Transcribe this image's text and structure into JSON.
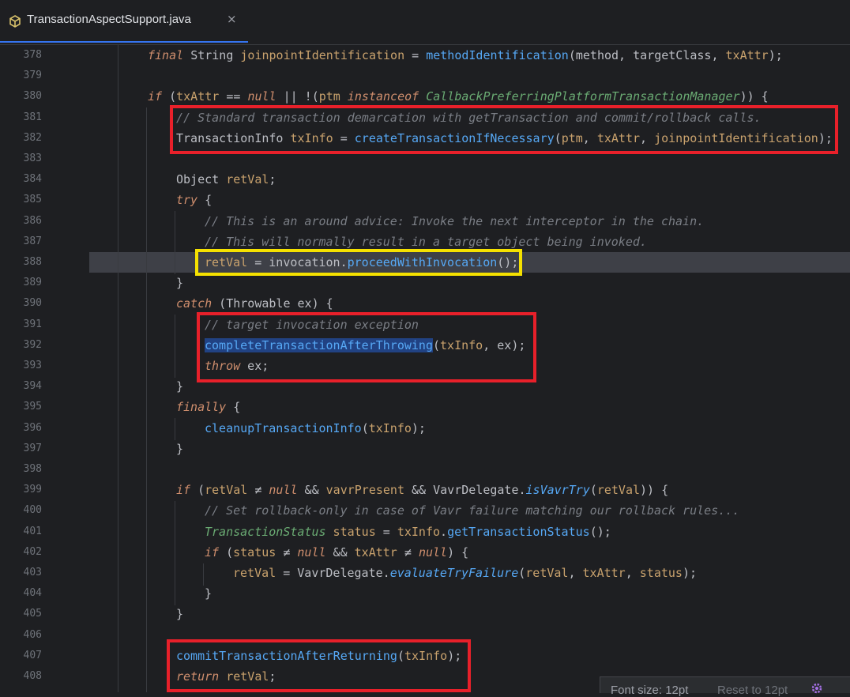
{
  "tab": {
    "title": "TransactionAspectSupport.java",
    "close_glyph": "×",
    "icon": "class-cube-icon"
  },
  "lines": [
    {
      "num": "378"
    },
    {
      "num": "379"
    },
    {
      "num": "380"
    },
    {
      "num": "381"
    },
    {
      "num": "382"
    },
    {
      "num": "383"
    },
    {
      "num": "384"
    },
    {
      "num": "385"
    },
    {
      "num": "386"
    },
    {
      "num": "387"
    },
    {
      "num": "388"
    },
    {
      "num": "389"
    },
    {
      "num": "390"
    },
    {
      "num": "391"
    },
    {
      "num": "392"
    },
    {
      "num": "393"
    },
    {
      "num": "394"
    },
    {
      "num": "395"
    },
    {
      "num": "396"
    },
    {
      "num": "397"
    },
    {
      "num": "398"
    },
    {
      "num": "399"
    },
    {
      "num": "400"
    },
    {
      "num": "401"
    },
    {
      "num": "402"
    },
    {
      "num": "403"
    },
    {
      "num": "404"
    },
    {
      "num": "405"
    },
    {
      "num": "406"
    },
    {
      "num": "407"
    },
    {
      "num": "408"
    }
  ],
  "code": {
    "l378": {
      "kw": "final",
      "type": "String",
      "var": "joinpointIdentification",
      "eq": " = ",
      "fn": "methodIdentification",
      "args": "(method, targetClass, ",
      "arg2": "txAttr",
      "end": ");"
    },
    "l380": {
      "kw": "if",
      "open": " (",
      "v1": "txAttr",
      "op": " == ",
      "null": "null",
      "or": " || !(",
      "v2": "ptm",
      "inst": " instanceof ",
      "cls": "CallbackPreferringPlatformTransactionManager",
      "end": ")) {"
    },
    "l381": {
      "comment": "// Standard transaction demarcation with getTransaction and commit/rollback calls."
    },
    "l382": {
      "type": "TransactionInfo",
      "var": " txInfo",
      "eq": " = ",
      "fn": "createTransactionIfNecessary",
      "a1": "(",
      "v1": "ptm",
      "c1": ", ",
      "v2": "txAttr",
      "c2": ", ",
      "v3": "joinpointIdentification",
      "end": ");"
    },
    "l384": {
      "type": "Object",
      "var": " retVal",
      "end": ";"
    },
    "l385": {
      "kw": "try",
      "end": " {"
    },
    "l386": {
      "comment": "// This is an around advice: Invoke the next interceptor in the chain."
    },
    "l387": {
      "comment": "// This will normally result in a target object being invoked."
    },
    "l388": {
      "v1": "retVal",
      "eq": " = ",
      "obj": "invocation.",
      "fn": "proceedWithInvocation",
      "end": "();"
    },
    "l389": {
      "text": "}"
    },
    "l390": {
      "kw": "catch",
      "open": " (",
      "type": "Throwable",
      "var": " ex",
      "end": ") {"
    },
    "l391": {
      "comment": "// target invocation exception"
    },
    "l392": {
      "fn": "completeTransactionAfterThrowing",
      "open": "(",
      "v1": "txInfo",
      "rest": ", ex);"
    },
    "l393": {
      "kw": "throw",
      "rest": " ex;"
    },
    "l394": {
      "text": "}"
    },
    "l395": {
      "kw": "finally",
      "end": " {"
    },
    "l396": {
      "fn": "cleanupTransactionInfo",
      "open": "(",
      "v1": "txInfo",
      "end": ");"
    },
    "l397": {
      "text": "}"
    },
    "l399": {
      "kw": "if",
      "open": " (",
      "v1": "retVal",
      "op": " ≠ ",
      "null": "null",
      "and1": " && ",
      "v2": "vavrPresent",
      "and2": " && ",
      "cls": "VavrDelegate.",
      "fn": "isVavrTry",
      "open2": "(",
      "v3": "retVal",
      "end": ")) {"
    },
    "l400": {
      "comment": "// Set rollback-only in case of Vavr failure matching our rollback rules..."
    },
    "l401": {
      "type": "TransactionStatus",
      "var": " status",
      "eq": " = ",
      "v1": "txInfo",
      "dot": ".",
      "fn": "getTransactionStatus",
      "end": "();"
    },
    "l402": {
      "kw": "if",
      "open": " (",
      "v1": "status",
      "op": " ≠ ",
      "null": "null",
      "and": " && ",
      "v2": "txAttr",
      "op2": " ≠ ",
      "null2": "null",
      "end": ") {"
    },
    "l403": {
      "v1": "retVal",
      "eq": " = ",
      "cls": "VavrDelegate.",
      "fn": "evaluateTryFailure",
      "open": "(",
      "v2": "retVal",
      "c1": ", ",
      "v3": "txAttr",
      "c2": ", ",
      "v4": "status",
      "end": ");"
    },
    "l404": {
      "text": "}"
    },
    "l405": {
      "text": "}"
    },
    "l407": {
      "fn": "commitTransactionAfterReturning",
      "open": "(",
      "v1": "txInfo",
      "end": ");"
    },
    "l408": {
      "kw": "return",
      "v1": " retVal",
      "end": ";"
    }
  },
  "fontbar": {
    "size_text": "Font size: 12pt",
    "reset_text": "Reset to 12pt",
    "icon": "gear-icon"
  },
  "colors": {
    "red_box": "#e8202a",
    "yellow_box": "#f5e100",
    "tab_accent": "#3574f0"
  }
}
